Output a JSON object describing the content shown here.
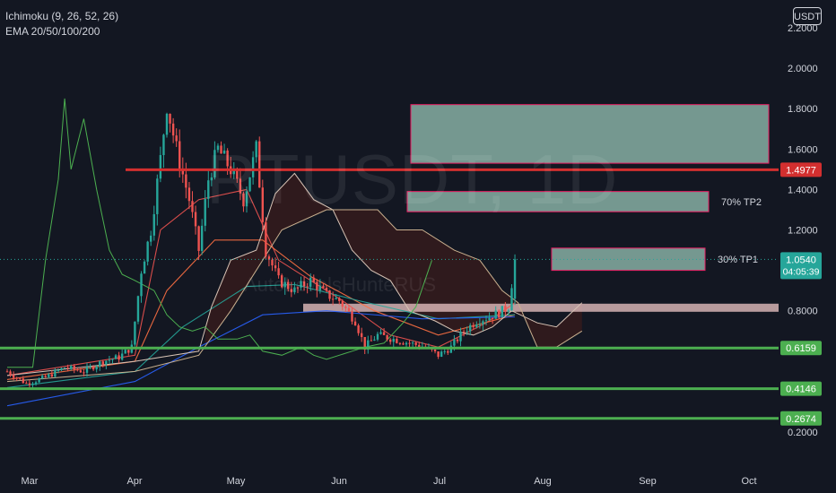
{
  "indicators": {
    "ichimoku": "Ichimoku (9, 26, 52, 26)",
    "ema": "EMA 20/50/100/200"
  },
  "currency_button": "USDT",
  "watermark": {
    "symbol": "RTUSDT, 1D",
    "sub": "AutoLevelsHunteRUS"
  },
  "colors": {
    "background": "#131722",
    "up_candle": "#26a69a",
    "down_candle": "#ef5350",
    "support_line": "#4caf50",
    "resistance_line": "#d32f2f",
    "target_box_fill": "#8fb9ad",
    "target_box_border": "#e91e63",
    "entry_zone_fill": "#d6b3b3",
    "cloud_fill": "#3a1c1c",
    "lagging_span": "#4caf50",
    "current_price_label": "#26a69a"
  },
  "chart_data": {
    "type": "candlestick",
    "x_axis": {
      "ticks": [
        "Mar",
        "Apr",
        "May",
        "Jun",
        "Jul",
        "Aug",
        "Sep",
        "Oct"
      ]
    },
    "y_axis": {
      "range": [
        0.13,
        2.3
      ],
      "ticks": [
        "2.2000",
        "2.0000",
        "1.8000",
        "1.6000",
        "1.4000",
        "1.2000",
        "0.8000",
        "0.2000"
      ]
    },
    "price_labels": [
      {
        "value": 1.4977,
        "text": "1.4977",
        "kind": "resistance"
      },
      {
        "value": 1.054,
        "text": "1.0540",
        "sub": "04:05:39",
        "kind": "current"
      },
      {
        "value": 0.6159,
        "text": "0.6159",
        "kind": "support"
      },
      {
        "value": 0.4146,
        "text": "0.4146",
        "kind": "support"
      },
      {
        "value": 0.2674,
        "text": "0.2674",
        "kind": "support"
      }
    ],
    "horizontal_lines": [
      {
        "value": 1.4977,
        "kind": "resistance"
      },
      {
        "value": 0.6159,
        "kind": "support"
      },
      {
        "value": 0.4146,
        "kind": "support"
      },
      {
        "value": 0.2674,
        "kind": "support"
      }
    ],
    "target_zones": [
      {
        "label": "",
        "top": 1.82,
        "bottom": 1.53
      },
      {
        "label": "70% TP2",
        "top": 1.39,
        "bottom": 1.29
      },
      {
        "label": "30% TP1",
        "top": 1.11,
        "bottom": 1.0
      },
      {
        "label": "",
        "kind": "entry",
        "top": 0.835,
        "bottom": 0.795
      }
    ],
    "price_series": [
      {
        "t": 0,
        "c": 0.5
      },
      {
        "t": 6,
        "c": 0.44
      },
      {
        "t": 12,
        "c": 0.47
      },
      {
        "t": 18,
        "c": 0.52
      },
      {
        "t": 24,
        "c": 0.5
      },
      {
        "t": 30,
        "c": 0.55
      },
      {
        "t": 35,
        "c": 0.57
      },
      {
        "t": 39,
        "c": 0.62
      },
      {
        "t": 42,
        "c": 1.0
      },
      {
        "t": 45,
        "c": 1.2
      },
      {
        "t": 48,
        "c": 1.55
      },
      {
        "t": 50,
        "c": 1.82
      },
      {
        "t": 53,
        "c": 1.6
      },
      {
        "t": 57,
        "c": 1.35
      },
      {
        "t": 60,
        "c": 1.1
      },
      {
        "t": 63,
        "c": 1.45
      },
      {
        "t": 66,
        "c": 1.6
      },
      {
        "t": 70,
        "c": 1.5
      },
      {
        "t": 74,
        "c": 1.35
      },
      {
        "t": 78,
        "c": 1.6
      },
      {
        "t": 81,
        "c": 1.1
      },
      {
        "t": 85,
        "c": 0.95
      },
      {
        "t": 90,
        "c": 0.9
      },
      {
        "t": 95,
        "c": 0.95
      },
      {
        "t": 100,
        "c": 0.88
      },
      {
        "t": 104,
        "c": 0.85
      },
      {
        "t": 109,
        "c": 0.75
      },
      {
        "t": 112,
        "c": 0.62
      },
      {
        "t": 116,
        "c": 0.68
      },
      {
        "t": 121,
        "c": 0.66
      },
      {
        "t": 126,
        "c": 0.64
      },
      {
        "t": 131,
        "c": 0.62
      },
      {
        "t": 135,
        "c": 0.58
      },
      {
        "t": 139,
        "c": 0.62
      },
      {
        "t": 143,
        "c": 0.7
      },
      {
        "t": 147,
        "c": 0.75
      },
      {
        "t": 151,
        "c": 0.77
      },
      {
        "t": 154,
        "c": 0.79
      },
      {
        "t": 157,
        "c": 0.82
      },
      {
        "t": 159,
        "c": 1.05
      }
    ],
    "ema_series": [
      {
        "name": "EMA 20",
        "color": "#ef5350",
        "points": [
          {
            "t": 0,
            "v": 0.48
          },
          {
            "t": 40,
            "v": 0.58
          },
          {
            "t": 48,
            "v": 1.2
          },
          {
            "t": 60,
            "v": 1.35
          },
          {
            "t": 75,
            "v": 1.4
          },
          {
            "t": 85,
            "v": 1.05
          },
          {
            "t": 105,
            "v": 0.85
          },
          {
            "t": 120,
            "v": 0.68
          },
          {
            "t": 135,
            "v": 0.62
          },
          {
            "t": 150,
            "v": 0.74
          },
          {
            "t": 159,
            "v": 0.84
          }
        ]
      },
      {
        "name": "EMA 50",
        "color": "#ff7043",
        "points": [
          {
            "t": 0,
            "v": 0.46
          },
          {
            "t": 40,
            "v": 0.55
          },
          {
            "t": 50,
            "v": 0.9
          },
          {
            "t": 65,
            "v": 1.15
          },
          {
            "t": 80,
            "v": 1.15
          },
          {
            "t": 95,
            "v": 0.97
          },
          {
            "t": 115,
            "v": 0.8
          },
          {
            "t": 135,
            "v": 0.68
          },
          {
            "t": 159,
            "v": 0.78
          }
        ]
      },
      {
        "name": "EMA 100",
        "color": "#26a69a",
        "points": [
          {
            "t": 0,
            "v": 0.42
          },
          {
            "t": 40,
            "v": 0.5
          },
          {
            "t": 55,
            "v": 0.72
          },
          {
            "t": 75,
            "v": 0.92
          },
          {
            "t": 90,
            "v": 0.93
          },
          {
            "t": 110,
            "v": 0.85
          },
          {
            "t": 135,
            "v": 0.76
          },
          {
            "t": 159,
            "v": 0.78
          }
        ]
      },
      {
        "name": "EMA 200",
        "color": "#2962ff",
        "points": [
          {
            "t": 0,
            "v": 0.33
          },
          {
            "t": 40,
            "v": 0.45
          },
          {
            "t": 60,
            "v": 0.62
          },
          {
            "t": 80,
            "v": 0.78
          },
          {
            "t": 100,
            "v": 0.8
          },
          {
            "t": 130,
            "v": 0.76
          },
          {
            "t": 159,
            "v": 0.77
          }
        ]
      }
    ],
    "ichimoku": {
      "lagging_span": [
        {
          "t": 0,
          "v": 0.52
        },
        {
          "t": 8,
          "v": 0.52
        },
        {
          "t": 12,
          "v": 1.05
        },
        {
          "t": 16,
          "v": 1.45
        },
        {
          "t": 18,
          "v": 1.85
        },
        {
          "t": 20,
          "v": 1.5
        },
        {
          "t": 24,
          "v": 1.75
        },
        {
          "t": 28,
          "v": 1.4
        },
        {
          "t": 32,
          "v": 1.1
        },
        {
          "t": 36,
          "v": 0.98
        },
        {
          "t": 40,
          "v": 0.95
        },
        {
          "t": 46,
          "v": 0.9
        },
        {
          "t": 50,
          "v": 0.78
        },
        {
          "t": 54,
          "v": 0.72
        },
        {
          "t": 58,
          "v": 0.7
        },
        {
          "t": 62,
          "v": 0.72
        },
        {
          "t": 66,
          "v": 0.66
        },
        {
          "t": 72,
          "v": 0.66
        },
        {
          "t": 76,
          "v": 0.68
        },
        {
          "t": 80,
          "v": 0.6
        },
        {
          "t": 86,
          "v": 0.58
        },
        {
          "t": 92,
          "v": 0.62
        },
        {
          "t": 96,
          "v": 0.58
        },
        {
          "t": 100,
          "v": 0.56
        },
        {
          "t": 108,
          "v": 0.6
        },
        {
          "t": 112,
          "v": 0.62
        },
        {
          "t": 118,
          "v": 0.64
        },
        {
          "t": 124,
          "v": 0.74
        },
        {
          "t": 128,
          "v": 0.82
        },
        {
          "t": 133,
          "v": 1.05
        }
      ],
      "span_a": [
        {
          "t": 0,
          "v": 0.48
        },
        {
          "t": 40,
          "v": 0.55
        },
        {
          "t": 60,
          "v": 0.6
        },
        {
          "t": 64,
          "v": 0.82
        },
        {
          "t": 70,
          "v": 1.05
        },
        {
          "t": 78,
          "v": 1.1
        },
        {
          "t": 84,
          "v": 1.38
        },
        {
          "t": 90,
          "v": 1.48
        },
        {
          "t": 96,
          "v": 1.35
        },
        {
          "t": 102,
          "v": 1.3
        },
        {
          "t": 108,
          "v": 1.1
        },
        {
          "t": 114,
          "v": 1.0
        },
        {
          "t": 120,
          "v": 0.95
        },
        {
          "t": 126,
          "v": 0.8
        },
        {
          "t": 134,
          "v": 0.75
        },
        {
          "t": 140,
          "v": 0.7
        },
        {
          "t": 146,
          "v": 0.68
        },
        {
          "t": 152,
          "v": 0.72
        },
        {
          "t": 158,
          "v": 0.8
        },
        {
          "t": 166,
          "v": 0.74
        },
        {
          "t": 172,
          "v": 0.72
        },
        {
          "t": 176,
          "v": 0.78
        },
        {
          "t": 180,
          "v": 0.84
        }
      ],
      "span_b": [
        {
          "t": 0,
          "v": 0.45
        },
        {
          "t": 40,
          "v": 0.5
        },
        {
          "t": 60,
          "v": 0.58
        },
        {
          "t": 70,
          "v": 0.8
        },
        {
          "t": 86,
          "v": 1.2
        },
        {
          "t": 100,
          "v": 1.3
        },
        {
          "t": 110,
          "v": 1.3
        },
        {
          "t": 116,
          "v": 1.3
        },
        {
          "t": 122,
          "v": 1.2
        },
        {
          "t": 130,
          "v": 1.2
        },
        {
          "t": 140,
          "v": 1.1
        },
        {
          "t": 148,
          "v": 1.05
        },
        {
          "t": 155,
          "v": 0.9
        },
        {
          "t": 160,
          "v": 0.84
        },
        {
          "t": 166,
          "v": 0.62
        },
        {
          "t": 172,
          "v": 0.62
        },
        {
          "t": 180,
          "v": 0.7
        }
      ]
    }
  }
}
